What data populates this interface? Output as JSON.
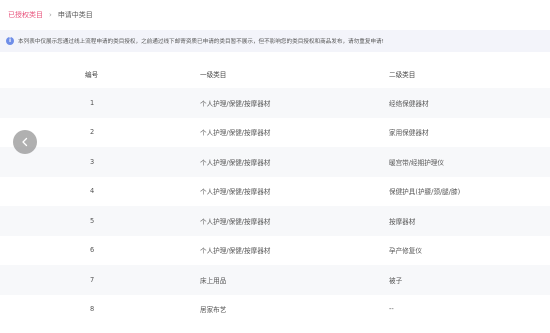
{
  "breadcrumb": {
    "active": "已授权类目",
    "separator": "›",
    "current": "申请中类目"
  },
  "notice": {
    "icon": "info-icon",
    "text": "本列表中仅展示您通过线上流程申请的类目授权，之前通过线下邮寄资质已申请的类目暂不展示，但不影响您的类目授权和商品发布，请勿重复申请!"
  },
  "table": {
    "headers": [
      "编号",
      "一级类目",
      "二级类目"
    ],
    "rows": [
      {
        "num": "1",
        "level1": "个人护理/保健/按摩器材",
        "level2": "经络保健器材"
      },
      {
        "num": "2",
        "level1": "个人护理/保健/按摩器材",
        "level2": "家用保健器材"
      },
      {
        "num": "3",
        "level1": "个人护理/保健/按摩器材",
        "level2": "暖宫带/经期护理仪"
      },
      {
        "num": "4",
        "level1": "个人护理/保健/按摩器材",
        "level2": "保健护具(护腰/颈/腿/膝)"
      },
      {
        "num": "5",
        "level1": "个人护理/保健/按摩器材",
        "level2": "按摩器材"
      },
      {
        "num": "6",
        "level1": "个人护理/保健/按摩器材",
        "level2": "孕产修复仪"
      },
      {
        "num": "7",
        "level1": "床上用品",
        "level2": "被子"
      },
      {
        "num": "8",
        "level1": "居家布艺",
        "level2": "--"
      }
    ]
  },
  "prev_button": {
    "icon": "chevron-left-icon"
  },
  "colors": {
    "accent": "#e8507a",
    "info": "#6f8ee8",
    "notice_bg": "#f3f4fa"
  }
}
